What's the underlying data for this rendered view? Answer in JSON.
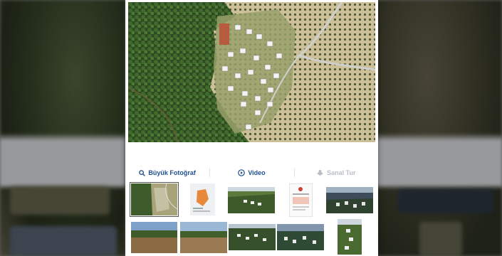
{
  "gallery": {
    "actions": [
      {
        "label": "Büyük Fotoğraf",
        "icon": "search-icon",
        "enabled": true
      },
      {
        "label": "Video",
        "icon": "play-circle-icon",
        "enabled": true
      },
      {
        "label": "Sanal Tur",
        "icon": "virtual-tour-icon",
        "enabled": false
      }
    ],
    "thumbnail_count": 10,
    "selected_thumbnail": 1
  },
  "colors": {
    "action_text": "#1e4f8f",
    "action_disabled": "#b9bec6",
    "panel_bg": "#ffffff"
  }
}
